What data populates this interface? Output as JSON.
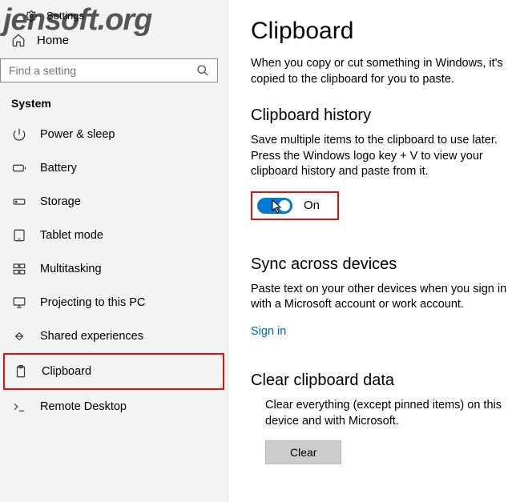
{
  "watermark": "jensoft.org",
  "header": {
    "settings": "Settings",
    "home": "Home"
  },
  "search": {
    "placeholder": "Find a setting"
  },
  "section_header": "System",
  "nav": {
    "power": "Power & sleep",
    "battery": "Battery",
    "storage": "Storage",
    "tablet": "Tablet mode",
    "multitasking": "Multitasking",
    "projecting": "Projecting to this PC",
    "shared": "Shared experiences",
    "clipboard": "Clipboard",
    "remote": "Remote Desktop"
  },
  "main": {
    "title": "Clipboard",
    "intro": "When you copy or cut something in Windows, it's copied to the clipboard for you to paste.",
    "history": {
      "heading": "Clipboard history",
      "desc": "Save multiple items to the clipboard to use later. Press the Windows logo key + V to view your clipboard history and paste from it.",
      "toggle_label": "On"
    },
    "sync": {
      "heading": "Sync across devices",
      "desc": "Paste text on your other devices when you sign in with a Microsoft account or work account.",
      "link": "Sign in"
    },
    "clear": {
      "heading": "Clear clipboard data",
      "desc": "Clear everything (except pinned items) on this device and with Microsoft.",
      "button": "Clear"
    }
  }
}
